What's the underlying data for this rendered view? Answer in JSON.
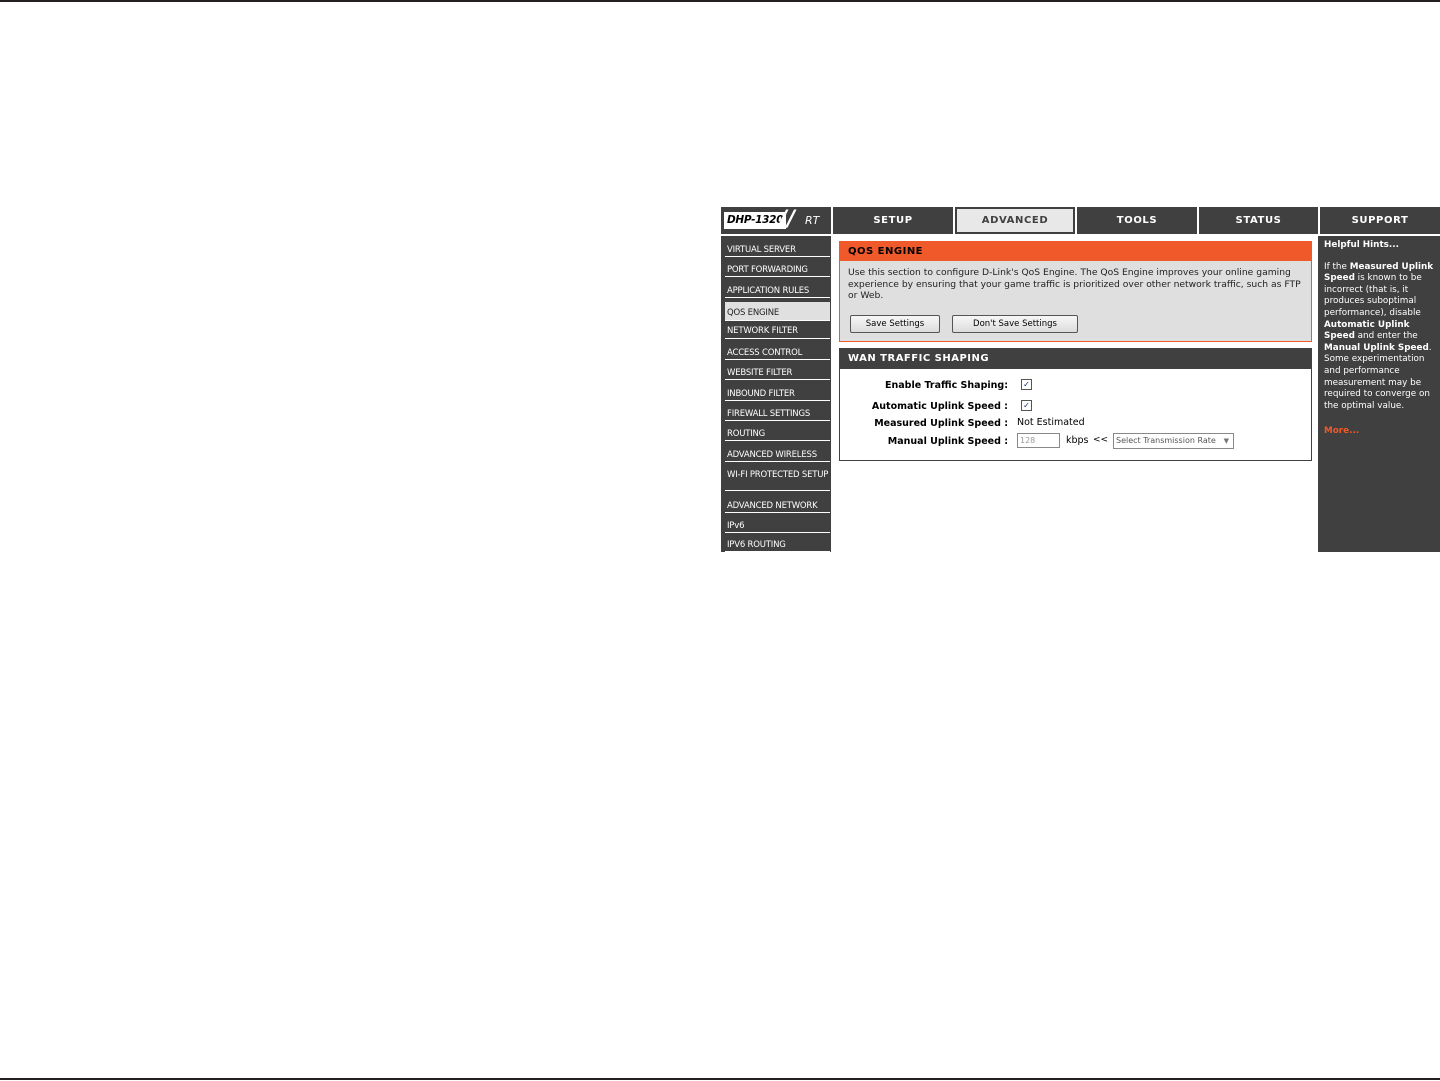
{
  "brand": {
    "model": "DHP-1320",
    "suffix": "RT"
  },
  "nav": {
    "tabs": [
      {
        "label": "SETUP"
      },
      {
        "label": "ADVANCED"
      },
      {
        "label": "TOOLS"
      },
      {
        "label": "STATUS"
      },
      {
        "label": "SUPPORT"
      }
    ],
    "active": "ADVANCED"
  },
  "sidebar": {
    "items": [
      {
        "label": "VIRTUAL SERVER"
      },
      {
        "label": "PORT FORWARDING"
      },
      {
        "label": "APPLICATION RULES"
      },
      {
        "label": "QOS ENGINE"
      },
      {
        "label": "NETWORK FILTER"
      },
      {
        "label": "ACCESS CONTROL"
      },
      {
        "label": "WEBSITE FILTER"
      },
      {
        "label": "INBOUND FILTER"
      },
      {
        "label": "FIREWALL SETTINGS"
      },
      {
        "label": "ROUTING"
      },
      {
        "label": "ADVANCED WIRELESS"
      },
      {
        "label": "WI-FI PROTECTED SETUP"
      },
      {
        "label": "ADVANCED NETWORK"
      },
      {
        "label": "IPv6"
      },
      {
        "label": "IPV6 ROUTING"
      }
    ],
    "active": "QOS ENGINE"
  },
  "qos": {
    "title": "QOS ENGINE",
    "description": "Use this section to configure D-Link's QoS Engine. The QoS Engine improves your online gaming experience by ensuring that your game traffic is prioritized over other network traffic, such as FTP or Web.",
    "save_label": "Save Settings",
    "dont_save_label": "Don't Save Settings"
  },
  "wan": {
    "title": "WAN TRAFFIC SHAPING",
    "enable_label": "Enable Traffic Shaping:",
    "enable_checked": true,
    "auto_label": "Automatic Uplink Speed :",
    "auto_checked": true,
    "measured_label": "Measured Uplink Speed :",
    "measured_value": "Not Estimated",
    "manual_label": "Manual Uplink Speed :",
    "manual_value": "128",
    "unit": "kbps",
    "arrow": "<<",
    "select_value": "Select Transmission Rate"
  },
  "hints": {
    "title": "Helpful Hints...",
    "p1": "If the ",
    "b1": "Measured Uplink Speed",
    "p2": " is known to be incorrect (that is, it produces suboptimal performance), disable ",
    "b2": "Automatic Uplink Speed",
    "p3": " and enter the ",
    "b3": "Manual Uplink Speed",
    "p4": ". Some experimentation and performance measurement may be required to converge on the optimal value.",
    "more": "More..."
  },
  "icons": {
    "checkbox_checked": "checkmark-icon",
    "select_caret": "chevron-down-icon"
  }
}
